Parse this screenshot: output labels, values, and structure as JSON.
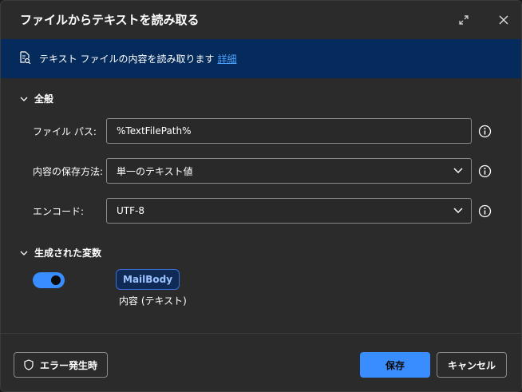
{
  "dialog": {
    "title": "ファイルからテキストを読み取る",
    "expand_icon": "expand-icon",
    "close_icon": "close-icon"
  },
  "banner": {
    "text": "テキスト ファイルの内容を読み取ります",
    "link": "詳細",
    "icon": "document-search-icon"
  },
  "general": {
    "header": "全般",
    "fields": [
      {
        "label": "ファイル パス:",
        "value": "%TextFilePath%"
      },
      {
        "label": "内容の保存方法:",
        "value": "単一のテキスト値"
      },
      {
        "label": "エンコード:",
        "value": "UTF-8"
      }
    ]
  },
  "variables": {
    "header": "生成された変数",
    "toggle_on": true,
    "name": "MailBody",
    "description": "内容 (テキスト)"
  },
  "footer": {
    "error_button": "エラー発生時",
    "save_button": "保存",
    "cancel_button": "キャンセル"
  },
  "colors": {
    "accent": "#3a8dff",
    "banner_bg": "#052b5c",
    "dialog_bg": "#2b2b2b"
  }
}
